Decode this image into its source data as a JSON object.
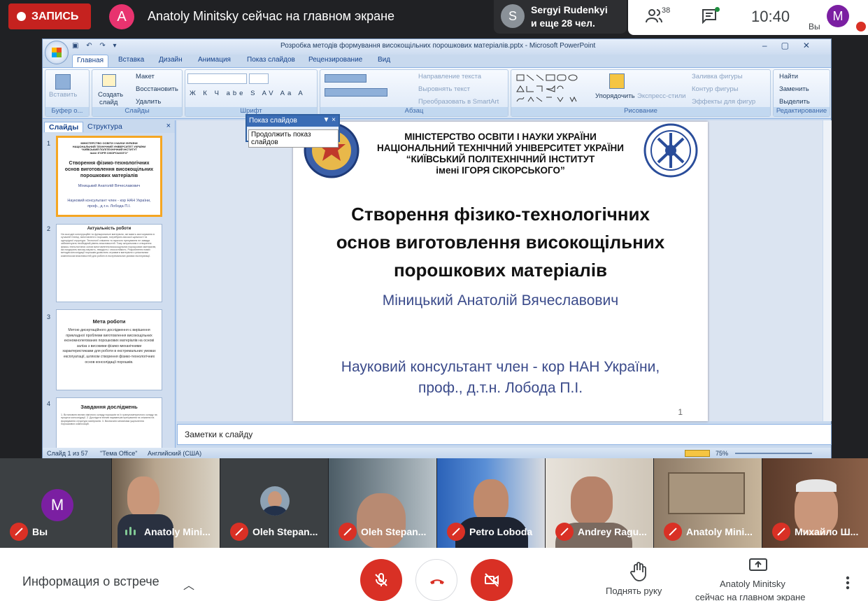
{
  "top": {
    "record_label": "ЗАПИСЬ",
    "presenter_initial": "A",
    "presenter_text": "Anatoly Minitsky сейчас на главном экране",
    "participant_initial": "S",
    "participant_name": "Sergyi Rudenkyi",
    "participant_more": "и еще 28 чел.",
    "people_count": "38",
    "time": "10:40",
    "me_initial": "M",
    "me_label": "Вы"
  },
  "ppt": {
    "window_title": "Розробка методів формування високощільних порошкових матеріалів.pptx - Microsoft PowerPoint",
    "tabs": [
      "Главная",
      "Вставка",
      "Дизайн",
      "Анимация",
      "Показ слайдов",
      "Рецензирование",
      "Вид"
    ],
    "ribbon": {
      "clipboard": {
        "paste": "Вставить",
        "group": "Буфер о..."
      },
      "slides": {
        "create": "Создать",
        "create2": "слайд",
        "layout": "Макет",
        "reset": "Восстановить",
        "delete": "Удалить",
        "group": "Слайды"
      },
      "font": {
        "group": "Шрифт",
        "buttons": [
          "Ж",
          "К",
          "Ч",
          "abe",
          "S",
          "AV",
          "Aa",
          "A"
        ]
      },
      "paragraph": {
        "text_direction": "Направление текста",
        "align_text": "Выровнять текст",
        "smartart": "Преобразовать в SmartArt",
        "group": "Абзац"
      },
      "drawing": {
        "arrange": "Упорядочить",
        "quick_styles": "Экспресс-стили",
        "fill": "Заливка фигуры",
        "outline": "Контур фигуры",
        "effects": "Эффекты для фигур",
        "group": "Рисование"
      },
      "editing": {
        "find": "Найти",
        "replace": "Заменить",
        "select": "Выделить",
        "group": "Редактирование"
      }
    },
    "pane_tabs": [
      "Слайды",
      "Структура"
    ],
    "float_toolbar": {
      "title": "Показ слайдов",
      "item": "Продолжить показ слайдов"
    },
    "thumbs": [
      {
        "num": "1",
        "h1": "МІНІСТЕРСТВО ОСВІТИ І НАУКИ УКРАЇНИ",
        "h2": "НАЦІОНАЛЬНИЙ ТЕХНІЧНИЙ УНІВЕРСИТЕТ УКРАЇНИ",
        "h3": "“КИЇВСЬКИЙ ПОЛІТЕХНІЧНИЙ ІНСТИТУТ",
        "h4": "імені ІГОРЯ СІКОРСЬКОГО”",
        "t1": "Створення фізико-технологічних",
        "t2": "основ виготовлення високощільних",
        "t3": "порошкових матеріалів",
        "a": "Міницький Анатолій Вячеславович",
        "c1": "Науковий консультант член - кор НАН України,",
        "c2": "проф., д.т.н. Лобода П.І."
      },
      {
        "num": "2",
        "title": "Актуальність роботи",
        "body": "На сьогодні конструкційні та функціональні матеріали, які мають застосування в сучасній техніці, виготовлені із порошків, потребують високої щільності та однорідної структури. Технології спікання та гарячого пресування не завжди забезпечують необхідний рівень властивостей. Тому актуальним є створення фізико-технологічних основ виготовлення високощільних порошкових матеріалів, які поєднують високу міцність, твердість і зносостійкість. Розроблення нових методів консолідації порошків дозволить отримати матеріали з унікальним комплексом властивостей для роботи в екстремальних умовах експлуатації."
      },
      {
        "num": "3",
        "title": "Мета роботи",
        "body": "Метою дисертаційного дослідження є вирішення прикладної проблеми виготовлення високощільних економнолегованих порошкових матеріалів на основі заліза з високими фізико-механічними характеристиками для роботи в екстремальних умовах експлуатації, шляхом створення фізико-технологічних основ консолідації порошків."
      },
      {
        "num": "4",
        "title": "Завдання досліджень",
        "body": "1. Встановити вплив хімічного складу порошків та їх гранулометричного складу на процеси консолідації. 2. Дослідити вплив параметрів пресування та спікання на формування структури матеріалів. 3. Визначити механізми ущільнення порошкових композицій."
      }
    ],
    "slide": {
      "h1": "МІНІСТЕРСТВО ОСВІТИ І НАУКИ УКРАЇНИ",
      "h2": "НАЦІОНАЛЬНИЙ ТЕХНІЧНИЙ УНІВЕРСИТЕТ УКРАЇНИ",
      "h3": "“КИЇВСЬКИЙ ПОЛІТЕХНІЧНИЙ ІНСТИТУТ",
      "h4": "імені ІГОРЯ СІКОРСЬКОГО”",
      "t1": "Створення фізико-технологічних",
      "t2": "основ виготовлення високощільних",
      "t3": "порошкових матеріалів",
      "author": "Міницький Анатолій Вячеславович",
      "cons1": "Науковий консультант член - кор НАН України,",
      "cons2": "проф., д.т.н. Лобода П.І.",
      "number": "1"
    },
    "notes_placeholder": "Заметки к слайду",
    "status": {
      "slide": "Слайд 1 из 57",
      "theme": "\"Тема Office\"",
      "lang": "Английский (США)",
      "zoom": "75%"
    }
  },
  "tiles": [
    {
      "name": "Вы",
      "initial": "M"
    },
    {
      "name": "Anatoly Mini..."
    },
    {
      "name": "Oleh Stepan..."
    },
    {
      "name": "Oleh Stepan..."
    },
    {
      "name": "Petro Loboda"
    },
    {
      "name": "Andrey Ragu..."
    },
    {
      "name": "Anatoly Mini..."
    },
    {
      "name": "Михайло Ш..."
    }
  ],
  "bottom": {
    "meeting_info": "Информация о встрече",
    "raise_hand": "Поднять руку",
    "presenting_l1": "Anatoly Minitsky",
    "presenting_l2": "сейчас на главном экране"
  },
  "colors": {
    "record": "#c5221f",
    "hangup": "#d93025",
    "ppt_blue": "#15428b"
  }
}
